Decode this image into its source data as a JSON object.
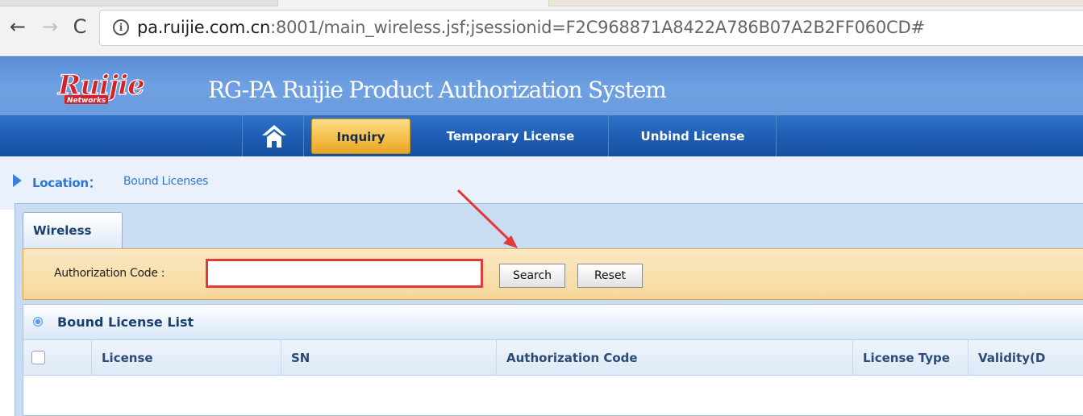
{
  "browser": {
    "back_glyph": "←",
    "forward_glyph": "→",
    "reload_glyph": "C",
    "info_glyph": "i",
    "url_host": "pa.ruijie.com.cn",
    "url_rest": ":8001/main_wireless.jsf;jsessionid=F2C968871A8422A786B07A2B2FF060CD#"
  },
  "header": {
    "logo_text": "Ruijie",
    "logo_sub": "Networks",
    "title": "RG-PA Ruijie Product Authorization System"
  },
  "menu": {
    "items": [
      {
        "label": "Inquiry",
        "active": true
      },
      {
        "label": "Temporary License",
        "active": false
      },
      {
        "label": "Unbind License",
        "active": false
      }
    ]
  },
  "location": {
    "label": "Location：",
    "value": "Bound Licenses"
  },
  "tabs": {
    "active": "Wireless"
  },
  "search": {
    "label": "Authorization Code :",
    "input_value": "",
    "search_label": "Search",
    "reset_label": "Reset"
  },
  "list": {
    "title": "Bound License List",
    "columns": [
      "License",
      "SN",
      "Authorization Code",
      "License Type",
      "Validity(D"
    ]
  },
  "colors": {
    "header_blue": "#5a8fd6",
    "menu_blue": "#1f5fb5",
    "active_tab_gold": "#f4c04a",
    "highlight_red": "#e23a3a",
    "search_bar": "#fbe9c4"
  }
}
